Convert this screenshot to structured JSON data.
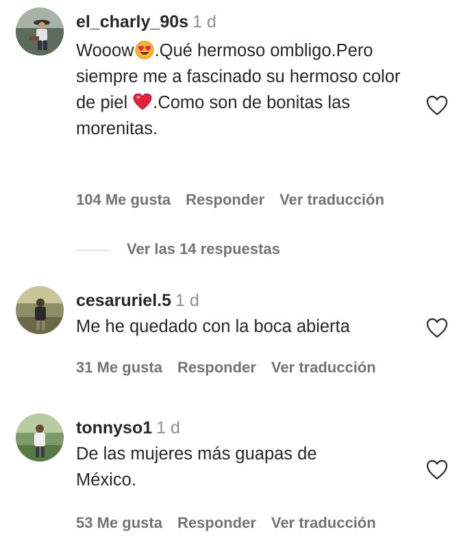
{
  "comments": [
    {
      "username": "el_charly_90s",
      "time": "1 d",
      "text_part1": "Wooow",
      "text_part2": ".Qué hermoso ombligo.Pero siempre me a fascinado su hermoso color de piel ",
      "text_part3": ".Como son de bonitas las morenitas.",
      "likes": "104 Me gusta",
      "reply": "Responder",
      "translate": "Ver traducción",
      "replies": "Ver las 14 respuestas"
    },
    {
      "username": "cesaruriel.5",
      "time": "1 d",
      "text": "Me he quedado con la boca abierta",
      "likes": "31 Me gusta",
      "reply": "Responder",
      "translate": "Ver traducción"
    },
    {
      "username": "tonnyso1",
      "time": "1 d",
      "text": "De las mujeres más guapas de México.",
      "likes": "53 Me gusta",
      "reply": "Responder",
      "translate": "Ver traducción"
    }
  ],
  "icons": {
    "like": "heart-outline-icon",
    "heart_eyes": "heart-eyes-emoji",
    "red_heart": "red-heart-emoji"
  },
  "colors": {
    "text": "#262626",
    "secondary": "#737373",
    "time": "#8e8e8e"
  }
}
